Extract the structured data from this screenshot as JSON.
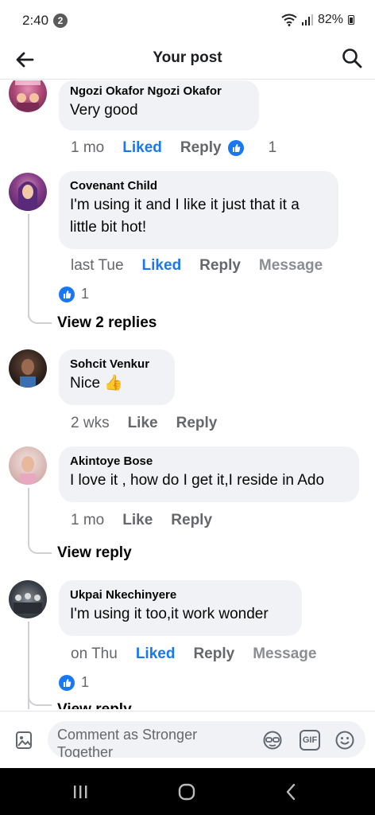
{
  "status": {
    "time": "2:40",
    "notif_count": "2",
    "battery": "82%"
  },
  "header": {
    "title": "Your post"
  },
  "comments": [
    {
      "author": "Ngozi Okafor Ngozi Okafor",
      "text": "Very good",
      "time": "1 mo",
      "like": "Liked",
      "reply": "Reply",
      "reactions": "1"
    },
    {
      "author": "Covenant Child",
      "text": "I'm using it and I like it just that it a little bit hot!",
      "time": "last Tue",
      "like": "Liked",
      "reply": "Reply",
      "message": "Message",
      "reactions": "1",
      "view_replies": "View 2 replies"
    },
    {
      "author": "Sohcit Venkur",
      "text": "Nice",
      "emoji": "👍",
      "time": "2 wks",
      "like": "Like",
      "reply": "Reply"
    },
    {
      "author": "Akintoye Bose",
      "text": "I love it , how do I get it,I reside in Ado",
      "time": "1 mo",
      "like": "Like",
      "reply": "Reply",
      "view_replies": "View reply"
    },
    {
      "author": "Ukpai Nkechinyere",
      "text": "I'm using it too,it work wonder",
      "time": "on Thu",
      "like": "Liked",
      "reply": "Reply",
      "message": "Message",
      "reactions": "1",
      "view_replies": "View reply"
    }
  ],
  "composer": {
    "placeholder": "Comment as Stronger Together",
    "gif_label": "GIF"
  },
  "colors": {
    "accent": "#1877f2",
    "bubble": "#f0f2f5",
    "muted": "#65676b"
  },
  "icons": [
    "back-arrow-icon",
    "search-icon",
    "like-thumb-icon",
    "photo-icon",
    "avatar-sticker-icon",
    "gif-icon",
    "emoji-icon",
    "recents-icon",
    "home-icon",
    "back-icon"
  ]
}
